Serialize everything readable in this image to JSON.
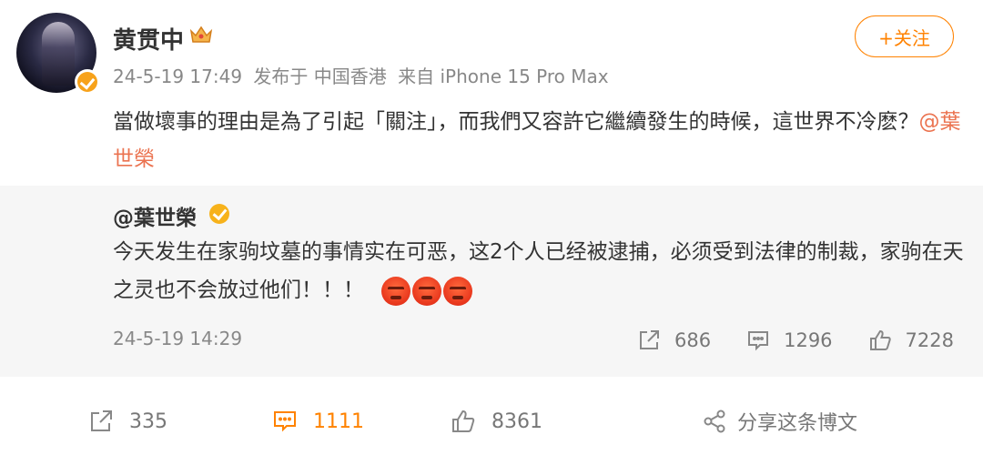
{
  "post": {
    "author": "黄贯中",
    "follow_label": "+关注",
    "meta": {
      "time": "24-5-19 17:49",
      "location": "发布于 中国香港",
      "source": "来自 iPhone 15 Pro Max"
    },
    "text_main": "當做壞事的理由是為了引起「關注」，而我們又容許它繼續發生的時候，這世界不冷麽？",
    "mention": "@葉世榮"
  },
  "repost": {
    "author": "@葉世榮",
    "text": "今天发生在家驹坟墓的事情实在可恶，这2个人已经被逮捕，必须受到法律的制裁，家驹在天之灵也不会放过他们！！！",
    "time": "24-5-19 14:29",
    "actions": {
      "share_count": "686",
      "comment_count": "1296",
      "like_count": "7228"
    },
    "emojis": [
      "angry-emoji",
      "angry-emoji",
      "angry-emoji"
    ]
  },
  "footer": {
    "share_count": "335",
    "comment_count": "1111",
    "like_count": "8361",
    "share_post_label": "分享这条博文"
  },
  "colors": {
    "accent": "#ff8200",
    "mention": "#eb7350",
    "repost_bg": "#f6f6f6"
  }
}
